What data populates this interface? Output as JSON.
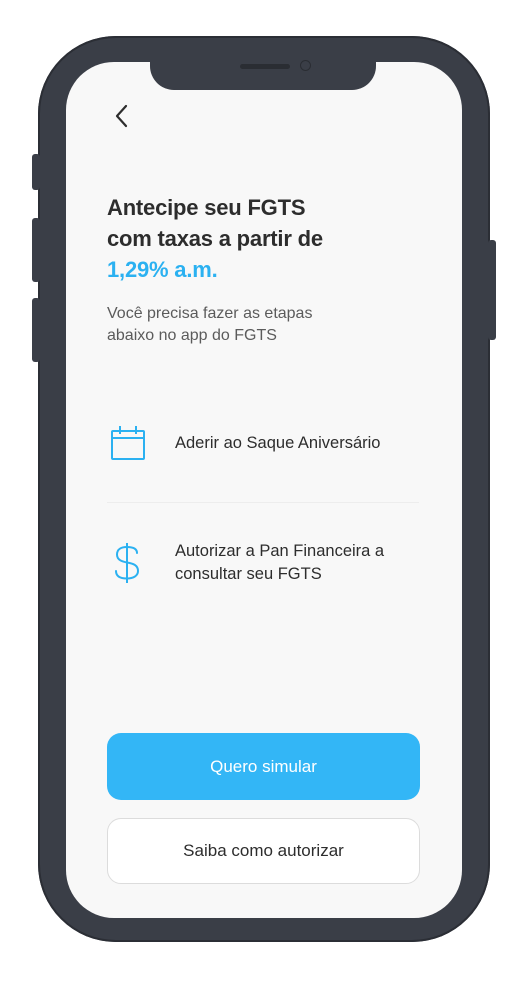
{
  "header": {
    "back_icon": "chevron-left-icon"
  },
  "hero": {
    "title_line1": "Antecipe seu FGTS",
    "title_line2": "com taxas a partir de",
    "rate": "1,29% a.m.",
    "subtitle_line1": "Você precisa fazer as etapas",
    "subtitle_line2": "abaixo no app do FGTS"
  },
  "steps": [
    {
      "icon": "calendar-icon",
      "line1": "Aderir ao Saque Aniversário"
    },
    {
      "icon": "dollar-icon",
      "line1": "Autorizar a Pan Financeira a",
      "line2": "consultar seu FGTS"
    }
  ],
  "actions": {
    "primary_label": "Quero simular",
    "secondary_label": "Saiba como autorizar"
  },
  "colors": {
    "accent": "#2bb1f1",
    "primary_button": "#33b6f6",
    "text": "#2d2d2d",
    "device_frame": "#3a3e47"
  }
}
